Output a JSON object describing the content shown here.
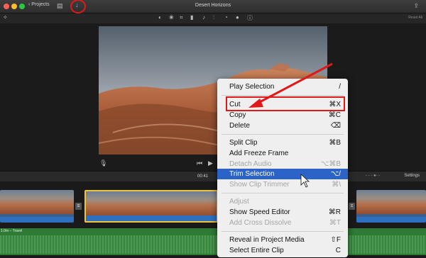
{
  "window": {
    "title": "Desert Horizons",
    "back_label": "Projects",
    "back_chevron": "‹",
    "media_icon": "▤",
    "import_icon": "↓",
    "share_icon": "⇪"
  },
  "viewer": {
    "reset_all": "Reset All",
    "timecode": "00:41",
    "settings": "Settings"
  },
  "timeline": {
    "audio_label": "1.0m – Travel"
  },
  "context_menu": {
    "items": [
      {
        "label": "Play Selection",
        "shortcut": "/"
      },
      {
        "label": "Cut",
        "shortcut": "⌘X"
      },
      {
        "label": "Copy",
        "shortcut": "⌘C"
      },
      {
        "label": "Delete",
        "shortcut": "⌫"
      },
      {
        "label": "Split Clip",
        "shortcut": "⌘B"
      },
      {
        "label": "Add Freeze Frame",
        "shortcut": ""
      },
      {
        "label": "Detach Audio",
        "shortcut": "⌥⌘B"
      },
      {
        "label": "Trim Selection",
        "shortcut": "⌥/"
      },
      {
        "label": "Show Clip Trimmer",
        "shortcut": "⌘\\"
      },
      {
        "label": "Adjust",
        "shortcut": ""
      },
      {
        "label": "Show Speed Editor",
        "shortcut": "⌘R"
      },
      {
        "label": "Add Cross Dissolve",
        "shortcut": "⌘T"
      },
      {
        "label": "Reveal in Project Media",
        "shortcut": "⇧F"
      },
      {
        "label": "Select Entire Clip",
        "shortcut": "C"
      }
    ]
  },
  "colors": {
    "highlight": "#2c63c6",
    "annotation_red": "#e01818",
    "selected_clip_border": "#f1c53a"
  }
}
